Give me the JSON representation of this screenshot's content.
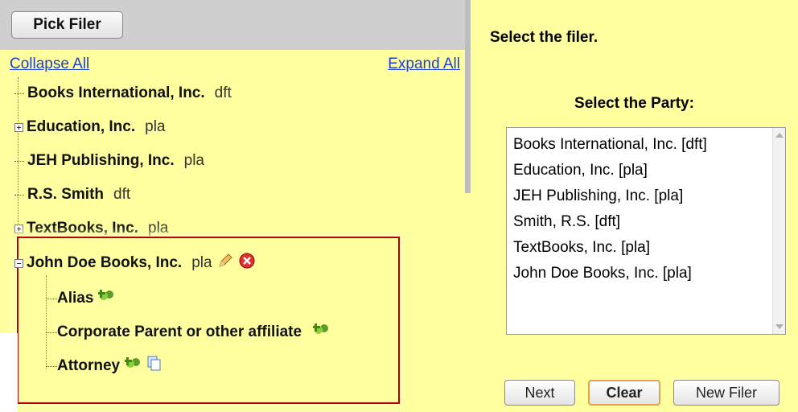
{
  "left": {
    "pick_filer_label": "Pick Filer",
    "collapse_all": "Collapse All",
    "expand_all": "Expand All",
    "tree": [
      {
        "name": "Books International, Inc.",
        "role": "dft",
        "expander": "none"
      },
      {
        "name": "Education, Inc.",
        "role": "pla",
        "expander": "plus"
      },
      {
        "name": "JEH Publishing, Inc.",
        "role": "pla",
        "expander": "none"
      },
      {
        "name": "R.S. Smith",
        "role": "dft",
        "expander": "none"
      },
      {
        "name": "TextBooks, Inc.",
        "role": "pla",
        "expander": "plus"
      },
      {
        "name": "John Doe Books, Inc.",
        "role": "pla",
        "expander": "minus"
      }
    ],
    "sub_items": [
      {
        "label": "Alias"
      },
      {
        "label": "Corporate Parent or other affiliate"
      },
      {
        "label": "Attorney"
      }
    ]
  },
  "right": {
    "instruction": "Select the filer.",
    "party_label": "Select the Party:",
    "parties": [
      "Books International, Inc. [dft]",
      "Education, Inc. [pla]",
      "JEH Publishing, Inc. [pla]",
      "Smith, R.S. [dft]",
      "TextBooks, Inc. [pla]",
      "John Doe Books, Inc. [pla]"
    ],
    "buttons": {
      "next": "Next",
      "clear": "Clear",
      "new_filer": "New Filer"
    }
  },
  "colors": {
    "panel_bg": "#ffffa0",
    "header_bg": "#cfcfcf",
    "link": "#1b3fd0",
    "highlight_border": "#b10000"
  },
  "icons": [
    "add-party-icon",
    "copy-icon",
    "edit-pencil-icon",
    "delete-icon"
  ]
}
